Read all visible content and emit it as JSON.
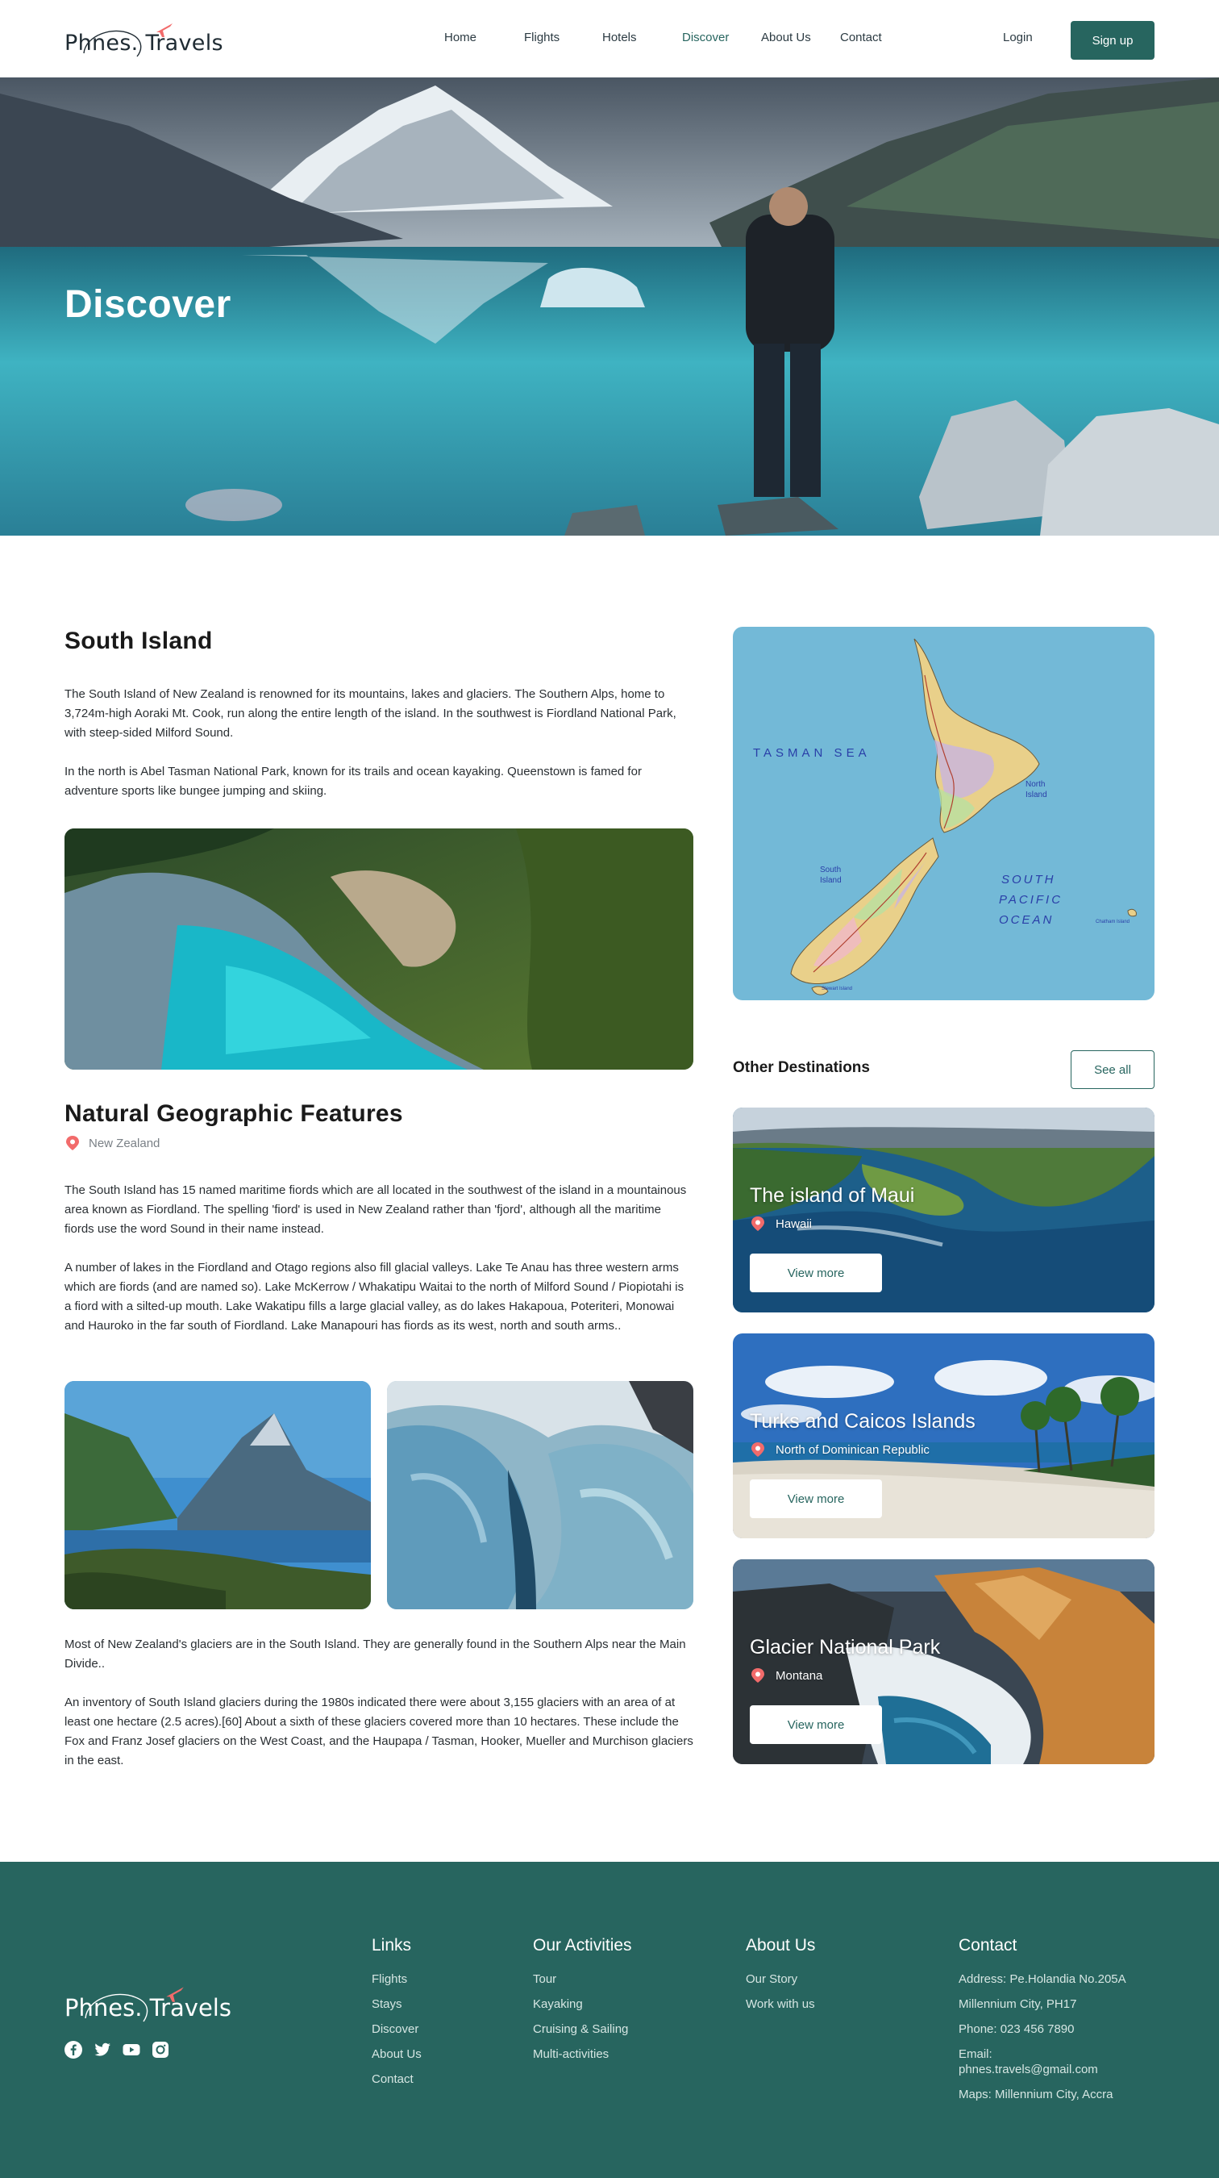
{
  "brand": {
    "name": "Phnes. Travels",
    "accent": "#27655f",
    "plane_color": "#f26b6b"
  },
  "nav": {
    "items": [
      {
        "label": "Home"
      },
      {
        "label": "Flights"
      },
      {
        "label": "Hotels"
      },
      {
        "label": "Discover",
        "active": true
      },
      {
        "label": "About Us"
      },
      {
        "label": "Contact"
      }
    ],
    "login": "Login",
    "signup": "Sign up"
  },
  "hero": {
    "title": "Discover"
  },
  "article": {
    "title": "South Island",
    "intro_paragraphs": [
      "The South Island of New Zealand is renowned for its mountains, lakes and glaciers. The Southern Alps, home to 3,724m-high Aoraki Mt. Cook, run along the entire length of the island. In the southwest is Fiordland National Park, with steep-sided Milford Sound.",
      "In the north is Abel Tasman National Park, known for its trails and ocean kayaking. Queenstown is famed for adventure sports like bungee jumping and skiing."
    ],
    "section_title": "Natural Geographic Features",
    "section_location": "New Zealand",
    "section_paragraphs": [
      "The South Island has 15 named maritime fiords which are all located in the southwest of the island in a mountainous area known as Fiordland. The spelling 'fiord' is used in New Zealand rather than 'fjord', although all the maritime fiords use the word Sound in their name instead.",
      "A number of lakes in the Fiordland and Otago regions also fill glacial valleys. Lake Te Anau has three western arms which are fiords (and are named so). Lake McKerrow / Whakatipu Waitai to the north of Milford Sound / Piopiotahi is a fiord with a silted-up mouth. Lake Wakatipu fills a large glacial valley, as do lakes Hakapoua, Poteriteri, Monowai and Hauroko in the far south of Fiordland. Lake Manapouri has fiords as its west, north and south arms.."
    ],
    "closing_paragraphs": [
      "Most of New Zealand's glaciers are in the South Island. They are generally found in the Southern Alps near the Main Divide..",
      "An inventory of South Island glaciers during the 1980s indicated there were about 3,155 glaciers with an area of at least one hectare (2.5 acres).[60] About a sixth of these glaciers covered more than 10 hectares. These include the Fox and Franz Josef glaciers on the West Coast, and the Haupapa / Tasman, Hooker, Mueller and Murchison glaciers in the east."
    ]
  },
  "map": {
    "labels": {
      "tasman_sea": "TASMAN SEA",
      "south_pacific_1": "SOUTH",
      "south_pacific_2": "PACIFIC",
      "south_pacific_3": "OCEAN",
      "north_island_1": "North",
      "north_island_2": "Island",
      "south_island_1": "South",
      "south_island_2": "Island",
      "chatham": "Chatham Island",
      "stewart": "Stewart Island"
    }
  },
  "other_destinations": {
    "title": "Other Destinations",
    "see_all": "See all",
    "cards": [
      {
        "name": "The island of Maui",
        "location": "Hawaii",
        "button": "View more"
      },
      {
        "name": "Turks and Caicos Islands",
        "location": "North of Dominican Republic",
        "button": "View more"
      },
      {
        "name": "Glacier National Park",
        "location": "Montana",
        "button": "View more"
      }
    ]
  },
  "footer": {
    "brand": "Phnes. Travels",
    "socials": [
      "facebook-icon",
      "twitter-icon",
      "youtube-icon",
      "instagram-icon"
    ],
    "links": {
      "title": "Links",
      "items": [
        "Flights",
        "Stays",
        "Discover",
        "About Us",
        "Contact"
      ]
    },
    "activities": {
      "title": "Our Activities",
      "items": [
        "Tour",
        "Kayaking",
        "Cruising & Sailing",
        "Multi-activities"
      ]
    },
    "about": {
      "title": "About Us",
      "items": [
        "Our Story",
        "Work with us"
      ]
    },
    "contact": {
      "title": "Contact",
      "address_1": "Address: Pe.Holandia No.205A",
      "address_2": "Millennium City,  PH17",
      "phone": "Phone: 023 456 7890",
      "email_label": "Email:",
      "email": "phnes.travels@gmail.com",
      "maps": "Maps: Millennium City, Accra"
    }
  }
}
